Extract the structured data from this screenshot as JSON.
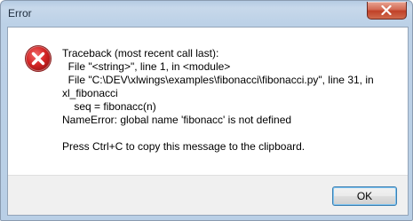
{
  "window": {
    "title": "Error"
  },
  "message": {
    "lines": [
      "Traceback (most recent call last):",
      "  File \"<string>\", line 1, in <module>",
      "  File \"C:\\DEV\\xlwings\\examples\\fibonacci\\fibonacci.py\", line 31, in",
      "xl_fibonacci",
      "    seq = fibonacc(n)",
      "NameError: global name 'fibonacc' is not defined",
      "",
      "Press Ctrl+C to copy this message to the clipboard."
    ]
  },
  "buttons": {
    "ok_label": "OK"
  },
  "icons": {
    "close": "close-icon",
    "error": "error-icon"
  },
  "colors": {
    "error_red": "#d22424",
    "titlebar": "#bcd1e7",
    "close_button": "#c74a2f"
  }
}
